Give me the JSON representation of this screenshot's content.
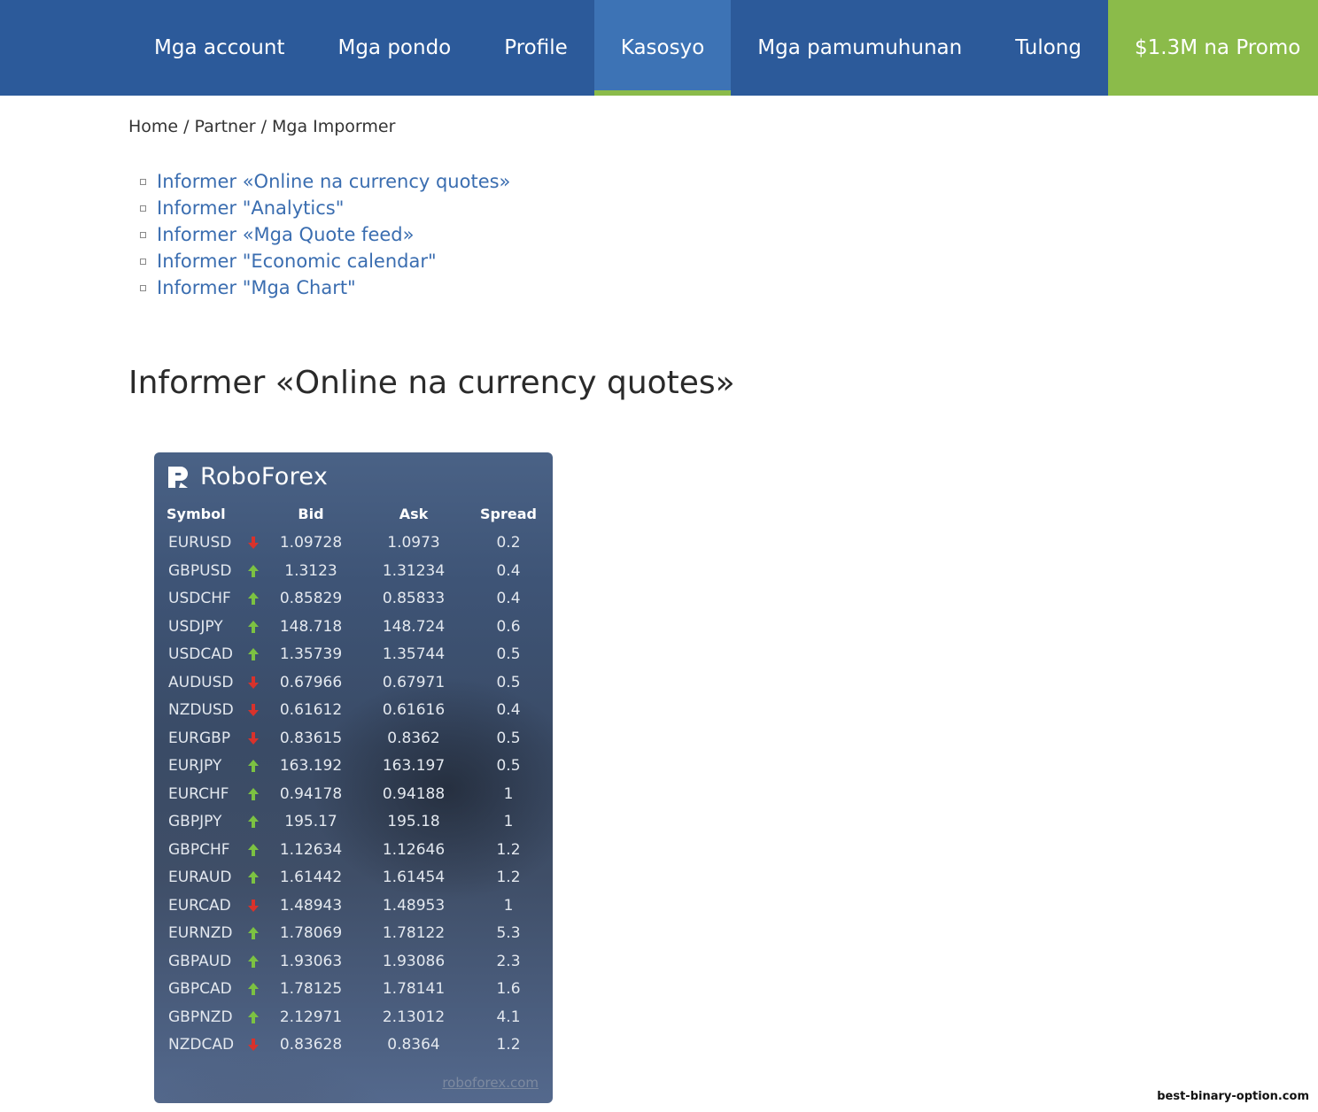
{
  "nav": {
    "items": [
      {
        "label": "Mga account",
        "active": false
      },
      {
        "label": "Mga pondo",
        "active": false
      },
      {
        "label": "Profile",
        "active": false
      },
      {
        "label": "Kasosyo",
        "active": true
      },
      {
        "label": "Mga pamumuhunan",
        "active": false
      },
      {
        "label": "Tulong",
        "active": false
      }
    ],
    "promo_label": "$1.3M na Promo",
    "colors": {
      "bar": "#2c5a9a",
      "active": "#3d73b5",
      "accent": "#8bbb4a"
    }
  },
  "breadcrumb": {
    "home": "Home",
    "partner": "Partner",
    "current": "Mga Impormer",
    "separator": "/"
  },
  "links": [
    "Informer «Online na currency quotes»",
    "Informer \"Analytics\"",
    "Informer «Mga Quote feed»",
    "Informer \"Economic calendar\"",
    "Informer \"Mga Chart\""
  ],
  "page_title": "Informer «Online na currency quotes»",
  "widget": {
    "brand": "RoboForex",
    "columns": {
      "symbol": "Symbol",
      "bid": "Bid",
      "ask": "Ask",
      "spread": "Spread"
    },
    "rows": [
      {
        "symbol": "EURUSD",
        "dir": "down",
        "bid": "1.09728",
        "ask": "1.0973",
        "spread": "0.2"
      },
      {
        "symbol": "GBPUSD",
        "dir": "up",
        "bid": "1.3123",
        "ask": "1.31234",
        "spread": "0.4"
      },
      {
        "symbol": "USDCHF",
        "dir": "up",
        "bid": "0.85829",
        "ask": "0.85833",
        "spread": "0.4"
      },
      {
        "symbol": "USDJPY",
        "dir": "up",
        "bid": "148.718",
        "ask": "148.724",
        "spread": "0.6"
      },
      {
        "symbol": "USDCAD",
        "dir": "up",
        "bid": "1.35739",
        "ask": "1.35744",
        "spread": "0.5"
      },
      {
        "symbol": "AUDUSD",
        "dir": "down",
        "bid": "0.67966",
        "ask": "0.67971",
        "spread": "0.5"
      },
      {
        "symbol": "NZDUSD",
        "dir": "down",
        "bid": "0.61612",
        "ask": "0.61616",
        "spread": "0.4"
      },
      {
        "symbol": "EURGBP",
        "dir": "down",
        "bid": "0.83615",
        "ask": "0.8362",
        "spread": "0.5"
      },
      {
        "symbol": "EURJPY",
        "dir": "up",
        "bid": "163.192",
        "ask": "163.197",
        "spread": "0.5"
      },
      {
        "symbol": "EURCHF",
        "dir": "up",
        "bid": "0.94178",
        "ask": "0.94188",
        "spread": "1"
      },
      {
        "symbol": "GBPJPY",
        "dir": "up",
        "bid": "195.17",
        "ask": "195.18",
        "spread": "1"
      },
      {
        "symbol": "GBPCHF",
        "dir": "up",
        "bid": "1.12634",
        "ask": "1.12646",
        "spread": "1.2"
      },
      {
        "symbol": "EURAUD",
        "dir": "up",
        "bid": "1.61442",
        "ask": "1.61454",
        "spread": "1.2"
      },
      {
        "symbol": "EURCAD",
        "dir": "down",
        "bid": "1.48943",
        "ask": "1.48953",
        "spread": "1"
      },
      {
        "symbol": "EURNZD",
        "dir": "up",
        "bid": "1.78069",
        "ask": "1.78122",
        "spread": "5.3"
      },
      {
        "symbol": "GBPAUD",
        "dir": "up",
        "bid": "1.93063",
        "ask": "1.93086",
        "spread": "2.3"
      },
      {
        "symbol": "GBPCAD",
        "dir": "up",
        "bid": "1.78125",
        "ask": "1.78141",
        "spread": "1.6"
      },
      {
        "symbol": "GBPNZD",
        "dir": "up",
        "bid": "2.12971",
        "ask": "2.13012",
        "spread": "4.1"
      },
      {
        "symbol": "NZDCAD",
        "dir": "down",
        "bid": "0.83628",
        "ask": "0.8364",
        "spread": "1.2"
      }
    ],
    "footer_link": "roboforex.com",
    "colors": {
      "up": "#7cc242",
      "down": "#d9322b"
    }
  },
  "watermark": "best-binary-option.com"
}
